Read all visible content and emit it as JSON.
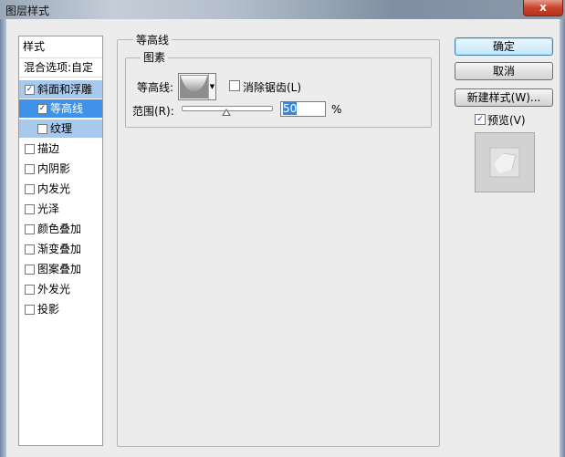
{
  "window": {
    "title": "图层样式",
    "close_label": "x"
  },
  "styles_list": {
    "header": "样式",
    "blend_options": "混合选项:自定",
    "items": [
      {
        "label": "斜面和浮雕",
        "checked": true
      },
      {
        "label": "等高线",
        "checked": true
      },
      {
        "label": "纹理",
        "checked": false
      },
      {
        "label": "描边",
        "checked": false
      },
      {
        "label": "内阴影",
        "checked": false
      },
      {
        "label": "内发光",
        "checked": false
      },
      {
        "label": "光泽",
        "checked": false
      },
      {
        "label": "颜色叠加",
        "checked": false
      },
      {
        "label": "渐变叠加",
        "checked": false
      },
      {
        "label": "图案叠加",
        "checked": false
      },
      {
        "label": "外发光",
        "checked": false
      },
      {
        "label": "投影",
        "checked": false
      }
    ]
  },
  "contour_panel": {
    "title": "等高线",
    "group_title": "图素",
    "contour_label": "等高线:",
    "anti_alias_label": "消除锯齿(L)",
    "range_label": "范围(R):",
    "range_value": "50",
    "range_unit": "%",
    "range_fraction": 0.5
  },
  "buttons": {
    "ok": "确定",
    "cancel": "取消",
    "new_style": "新建样式(W)...",
    "preview_label": "预览(V)",
    "preview_checked": true
  },
  "colors": {
    "selected_row": "#3f92e8",
    "parent_row": "#a9c9ec",
    "dialog_bg": "#ececec"
  }
}
